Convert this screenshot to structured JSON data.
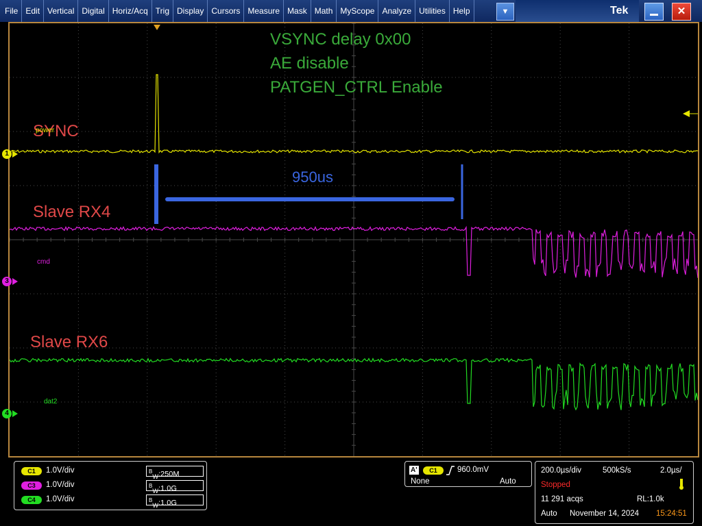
{
  "menubar": {
    "items": [
      "File",
      "Edit",
      "Vertical",
      "Digital",
      "Horiz/Acq",
      "Trig",
      "Display",
      "Cursors",
      "Measure",
      "Mask",
      "Math",
      "MyScope",
      "Analyze",
      "Utilities",
      "Help"
    ],
    "more_icon": "▼",
    "logo": "Tek",
    "minimize_icon": "minimize-icon",
    "close_icon": "✕"
  },
  "screen": {
    "annotations": {
      "line1": "VSYNC delay 0x00",
      "line2": "AE disable",
      "line3": "PATGEN_CTRL Enable",
      "measure": "950us",
      "label_vsync": "SYNC",
      "label_rx4": "Slave RX4",
      "label_rx6": "Slave RX6"
    },
    "channel_labels": {
      "ch1": "power",
      "ch3": "cmd",
      "ch4": "dat2"
    },
    "markers": {
      "ch1": "1",
      "ch3": "3",
      "ch4": "4"
    },
    "colors": {
      "ch1": "#e6e600",
      "ch3": "#e01fe0",
      "ch4": "#22dd22",
      "grid": "#4a4a4a",
      "annotation_green": "#3aaa3a",
      "annotation_red": "#e04848",
      "annotation_blue": "#3a66e0"
    }
  },
  "vertical": {
    "channels": [
      {
        "badge": "C1",
        "scale": "1.0V/div",
        "bw_prefix": "B",
        "bw_sub": "W",
        "bw_value": ":250M",
        "color": "#e6e600"
      },
      {
        "badge": "C3",
        "scale": "1.0V/div",
        "bw_prefix": "B",
        "bw_sub": "W",
        "bw_value": ":1.0G",
        "color": "#e01fe0"
      },
      {
        "badge": "C4",
        "scale": "1.0V/div",
        "bw_prefix": "B",
        "bw_sub": "W",
        "bw_value": ":1.0G",
        "color": "#22dd22"
      }
    ]
  },
  "trigger": {
    "id": "A'",
    "source": "C1",
    "level": "960.0mV",
    "coupling": "None",
    "mode": "Auto"
  },
  "acquisition": {
    "timebase": "200.0µs/div",
    "sample_rate": "500kS/s",
    "resolution": "2.0µs/",
    "status": "Stopped",
    "acqs": "11 291 acqs",
    "record_length": "RL:1.0k",
    "mode": "Auto",
    "date": "November 14, 2024",
    "time": "15:24:51"
  }
}
